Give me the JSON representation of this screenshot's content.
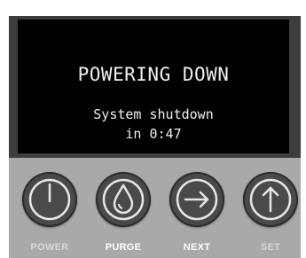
{
  "screen": {
    "title": "POWERING DOWN",
    "line1": "System shutdown",
    "line2": "in 0:47"
  },
  "buttons": {
    "power": {
      "label": "POWER",
      "icon": "power-icon",
      "label_color": "#d8d8d8"
    },
    "purge": {
      "label": "PURGE",
      "icon": "droplet-icon",
      "label_color": "#ffffff"
    },
    "next": {
      "label": "NEXT",
      "icon": "arrow-right-icon",
      "label_color": "#ffffff"
    },
    "set": {
      "label": "SET",
      "icon": "arrow-up-icon",
      "label_color": "#d8d8d8"
    }
  },
  "colors": {
    "device_body": "#3d3d3d",
    "screen_bg": "#000000",
    "screen_text": "#f0f0f0",
    "panel_bg": "#a9a9a9",
    "button_bg": "#4a4a4a"
  }
}
